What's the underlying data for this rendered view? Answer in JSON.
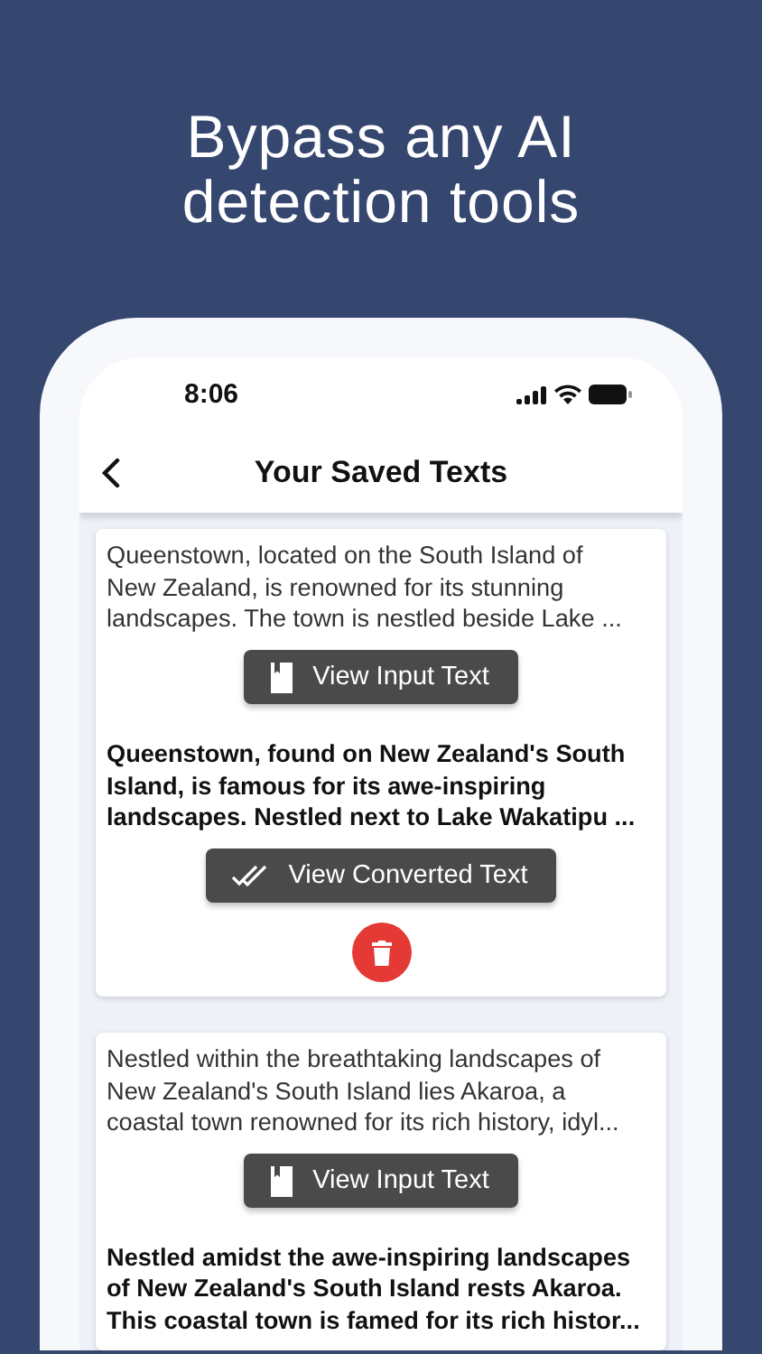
{
  "headline": "Bypass any AI detection tools",
  "status_bar": {
    "time": "8:06"
  },
  "nav": {
    "title": "Your Saved Texts"
  },
  "saved_texts": [
    {
      "input_lines": [
        "Queenstown, located on the South Island of",
        "New Zealand, is renowned for its stunning",
        "landscapes. The town is nestled beside Lake ..."
      ],
      "input_button": "View Input Text",
      "converted_lines": [
        "Queenstown, found on New Zealand's South",
        "Island, is famous for its awe-inspiring",
        "landscapes. Nestled next to Lake Wakatipu ..."
      ],
      "converted_button": "View Converted Text",
      "deletable": true
    },
    {
      "input_lines": [
        "Nestled within the breathtaking landscapes of",
        "New Zealand's South Island lies Akaroa, a",
        "coastal town renowned for its rich history, idyl..."
      ],
      "input_button": "View Input Text",
      "converted_lines": [
        "Nestled amidst the awe-inspiring landscapes",
        "of New Zealand's South Island rests Akaroa.",
        "This coastal town is famed for its rich histor..."
      ]
    }
  ]
}
